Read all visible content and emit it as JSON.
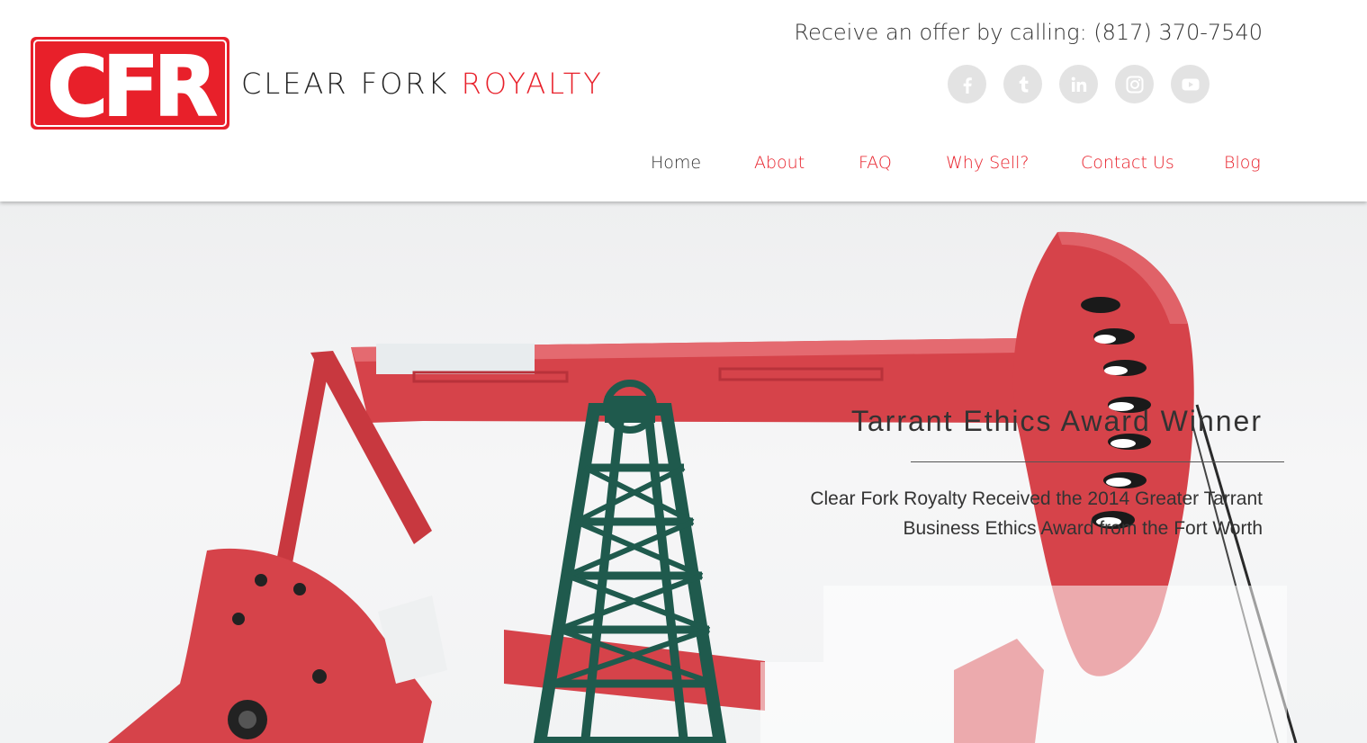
{
  "brand": {
    "logo_text": "CFR",
    "name_part1": "CLEAR FORK",
    "name_part2": "ROYALTY"
  },
  "header": {
    "phone": "Receive an offer by calling: (817) 370-7540"
  },
  "social": [
    {
      "name": "facebook-icon"
    },
    {
      "name": "tumblr-icon"
    },
    {
      "name": "linkedin-icon"
    },
    {
      "name": "instagram-icon"
    },
    {
      "name": "youtube-icon"
    }
  ],
  "nav": {
    "items": [
      {
        "label": "Home",
        "active": true
      },
      {
        "label": "About"
      },
      {
        "label": "FAQ"
      },
      {
        "label": "Why Sell?"
      },
      {
        "label": "Contact Us"
      },
      {
        "label": "Blog"
      }
    ]
  },
  "hero": {
    "award_title": "Tarrant Ethics Award Winner",
    "award_text": "Clear Fork Royalty Received the 2014 Greater Tarrant Business Ethics Award from the Fort Worth"
  },
  "colors": {
    "accent": "#e8202a",
    "text": "#333333",
    "pump_red": "#d6434a",
    "derrick_green": "#1f5a4d",
    "social_bg": "#e3e3e3"
  }
}
